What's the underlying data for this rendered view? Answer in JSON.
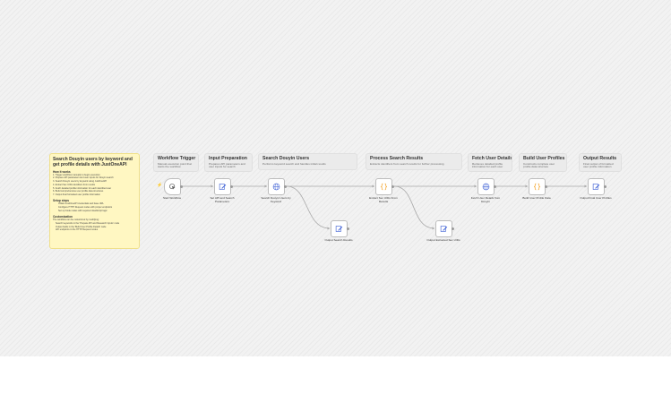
{
  "stickies": [
    {
      "id": "trigger",
      "title": "Workflow Trigger",
      "desc": "Manual execution point that starts the workflow"
    },
    {
      "id": "input",
      "title": "Input Preparation",
      "desc": "Prepares API parameters and user inputs for search"
    },
    {
      "id": "search",
      "title": "Search Douyin Users",
      "desc": "Performs keyword search and handles initial results"
    },
    {
      "id": "process",
      "title": "Process Search Results",
      "desc": "Extracts identifiers from search results for further processing"
    },
    {
      "id": "fetch",
      "title": "Fetch User Details",
      "desc": "Retrieves detailed profile information for each user"
    },
    {
      "id": "build",
      "title": "Build User Profiles",
      "desc": "Constructs complete user profile data structure"
    },
    {
      "id": "output",
      "title": "Output Results",
      "desc": "Final output of formatted user profile information"
    }
  ],
  "main_note": {
    "title": "Search Douyin users by keyword and get profile details with JustOneAPI",
    "how_heading": "How it works",
    "how_items": [
      "1. Trigger workflow manually to begin execution",
      "2. Prepare API parameters and user inputs for Douyin search",
      "3. Search Douyin users by keyword using JustOneAPI",
      "4. Extract Sec UIDs identifiers from results",
      "5. Fetch detailed profile information for each identified user",
      "6. Build comprehensive user profile data structures",
      "7. Output final formatted user profile information"
    ],
    "setup_heading": "Setup steps",
    "setup_items": [
      "Obtain JustOneAPI credentials and base URL",
      "Configure HTTP Request nodes with proper endpoints",
      "Set up Code nodes with required JavaScript logic"
    ],
    "custom_heading": "Customization",
    "custom_intro": "The workflow can be customized by modifying:",
    "custom_items": [
      "Search keywords in the 'Prepare API and Research Inputs' node",
      "Output fields in the 'Build User Profile Details' node",
      "API endpoints in the HTTP Request nodes"
    ]
  },
  "nodes": [
    {
      "id": "start",
      "label": "Start Workflow",
      "icon": "cursor-click-icon",
      "color": "#555555"
    },
    {
      "id": "setapi",
      "label": "Set API and Search Parameters",
      "icon": "pencil-icon",
      "color": "#4b6bd8"
    },
    {
      "id": "searchnode",
      "label": "Search Douyin Users by Keyword",
      "icon": "globe-icon",
      "color": "#4b6bd8"
    },
    {
      "id": "extract",
      "label": "Extract Sec UIDs From Results",
      "icon": "code-braces-icon",
      "color": "#f4a020"
    },
    {
      "id": "fetchnode",
      "label": "Fetch User Details from Douyin",
      "icon": "globe-icon",
      "color": "#4b6bd8"
    },
    {
      "id": "buildnode",
      "label": "Build User Profile Data",
      "icon": "code-braces-icon",
      "color": "#f4a020"
    },
    {
      "id": "outputfinal",
      "label": "Output Final User Profiles",
      "icon": "pencil-icon",
      "color": "#4b6bd8"
    },
    {
      "id": "outsearch",
      "label": "Output Search Results",
      "icon": "pencil-icon",
      "color": "#4b6bd8"
    },
    {
      "id": "outsecuids",
      "label": "Output Extracted Sec UIDs",
      "icon": "pencil-icon",
      "color": "#4b6bd8"
    }
  ],
  "trigger_icon": "lightning-icon"
}
